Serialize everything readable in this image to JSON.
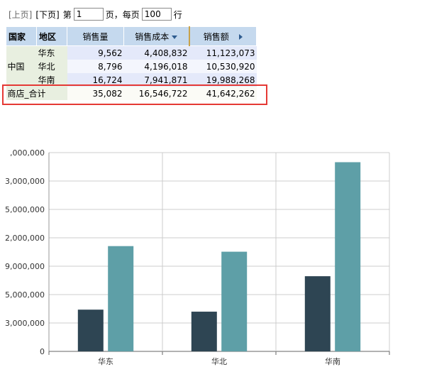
{
  "pager": {
    "prev_label": "[上页]",
    "next_label": "[下页]",
    "page_prefix": "第",
    "page_value": "1",
    "page_suffix": "页，",
    "per_page_label": "每页",
    "per_page_value": "100",
    "rows_suffix": "行"
  },
  "table": {
    "headers": {
      "country": "国家",
      "region": "地区",
      "qty": "销售量",
      "cost": "销售成本",
      "amount": "销售额"
    },
    "country": "中国",
    "rows": [
      {
        "region": "华东",
        "qty": "9,562",
        "cost": "4,408,832",
        "amount": "11,123,073"
      },
      {
        "region": "华北",
        "qty": "8,796",
        "cost": "4,196,018",
        "amount": "10,530,920"
      },
      {
        "region": "华南",
        "qty": "16,724",
        "cost": "7,941,871",
        "amount": "19,988,268"
      }
    ],
    "total": {
      "label": "商店_合计",
      "qty": "35,082",
      "cost": "16,546,722",
      "amount": "41,642,262"
    }
  },
  "colors": {
    "series_dark": "#2e4553",
    "series_teal": "#5e9fa7",
    "header_bg": "#c5d9ee",
    "highlight": "#e53935"
  },
  "chart_data": {
    "type": "bar",
    "categories": [
      "华东",
      "华北",
      "华南"
    ],
    "series": [
      {
        "values": [
          4408832,
          4196018,
          7941871
        ]
      },
      {
        "values": [
          11123073,
          10530920,
          19988268
        ]
      }
    ],
    "ytick_labels": [
      ",000,000",
      "3,000,000",
      "5,000,000",
      "2,000,000",
      "9,000,000",
      "5,000,000",
      "3,000,000",
      "0"
    ],
    "ylim": [
      0,
      21000000
    ],
    "grid": true
  }
}
